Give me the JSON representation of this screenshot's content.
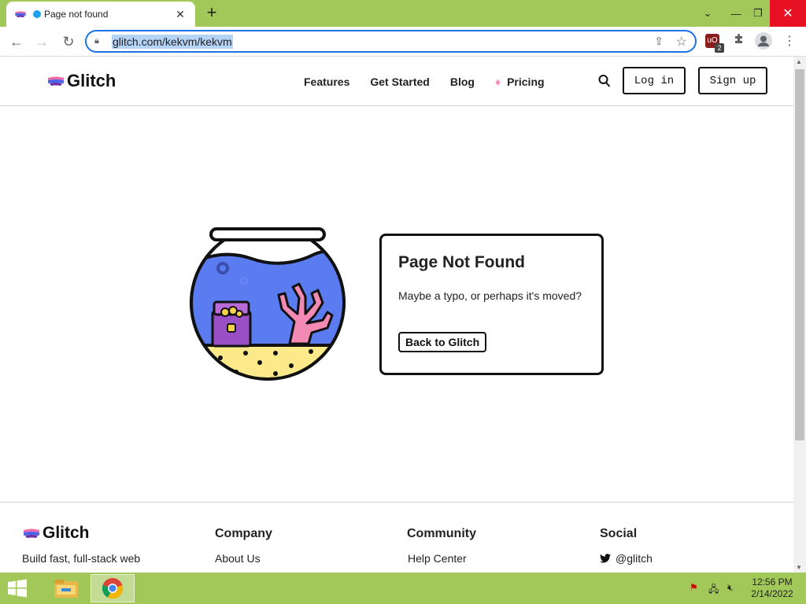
{
  "browser": {
    "tab_title": "Page not found",
    "url": "glitch.com/kekvm/kekvm",
    "extension_badge_count": "2",
    "new_tab_label": "+"
  },
  "site": {
    "brand": "Glitch",
    "nav": [
      "Features",
      "Get Started",
      "Blog",
      "Pricing"
    ],
    "login_label": "Log in",
    "signup_label": "Sign up"
  },
  "card": {
    "title": "Page Not Found",
    "message": "Maybe a typo, or perhaps it's moved?",
    "back_label": "Back to Glitch"
  },
  "footer": {
    "brand": "Glitch",
    "tagline": "Build fast, full-stack web",
    "columns": [
      {
        "heading": "Company",
        "link": "About Us"
      },
      {
        "heading": "Community",
        "link": "Help Center"
      },
      {
        "heading": "Social",
        "link": "@glitch"
      }
    ]
  },
  "taskbar": {
    "time": "12:56 PM",
    "date": "2/14/2022"
  },
  "colors": {
    "chrome_green": "#a3c85a",
    "bowl_water": "#5b7cf0",
    "sand": "#fbe98a",
    "coral": "#f28ab4",
    "chest": "#9b4fc4"
  }
}
